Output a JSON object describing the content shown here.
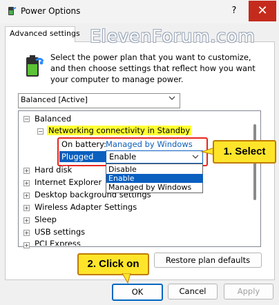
{
  "window": {
    "title": "Power Options",
    "help_label": "?",
    "close_label": "✕"
  },
  "tab": {
    "label": "Advanced settings"
  },
  "watermark": "ElevenForum.com",
  "description": "Select the power plan that you want to customize, and then choose settings that reflect how you want your computer to manage power.",
  "plan_select": {
    "value": "Balanced [Active]"
  },
  "tree": {
    "balanced": "Balanced",
    "networking": "Networking connectivity in Standby",
    "on_battery_label": "On battery:",
    "on_battery_value": "Managed by Windows",
    "plugged_in_label": "Plugged in:",
    "plugged_in_value": "Enable",
    "dropdown_options": [
      "Disable",
      "Enable",
      "Managed by Windows"
    ],
    "items": [
      "Hard disk",
      "Internet Explorer",
      "Desktop background settings",
      "Wireless Adapter Settings",
      "Sleep",
      "USB settings",
      "PCI Express"
    ]
  },
  "callouts": {
    "select": "1. Select",
    "click_ok": "2. Click on"
  },
  "buttons": {
    "restore": "Restore plan defaults",
    "ok": "OK",
    "cancel": "Cancel",
    "apply": "Apply"
  },
  "colors": {
    "accent": "#0a5fbf",
    "highlight": "#ffff33",
    "callout": "#ffe52a",
    "frame": "#e8241c",
    "close": "#c42b1c"
  }
}
